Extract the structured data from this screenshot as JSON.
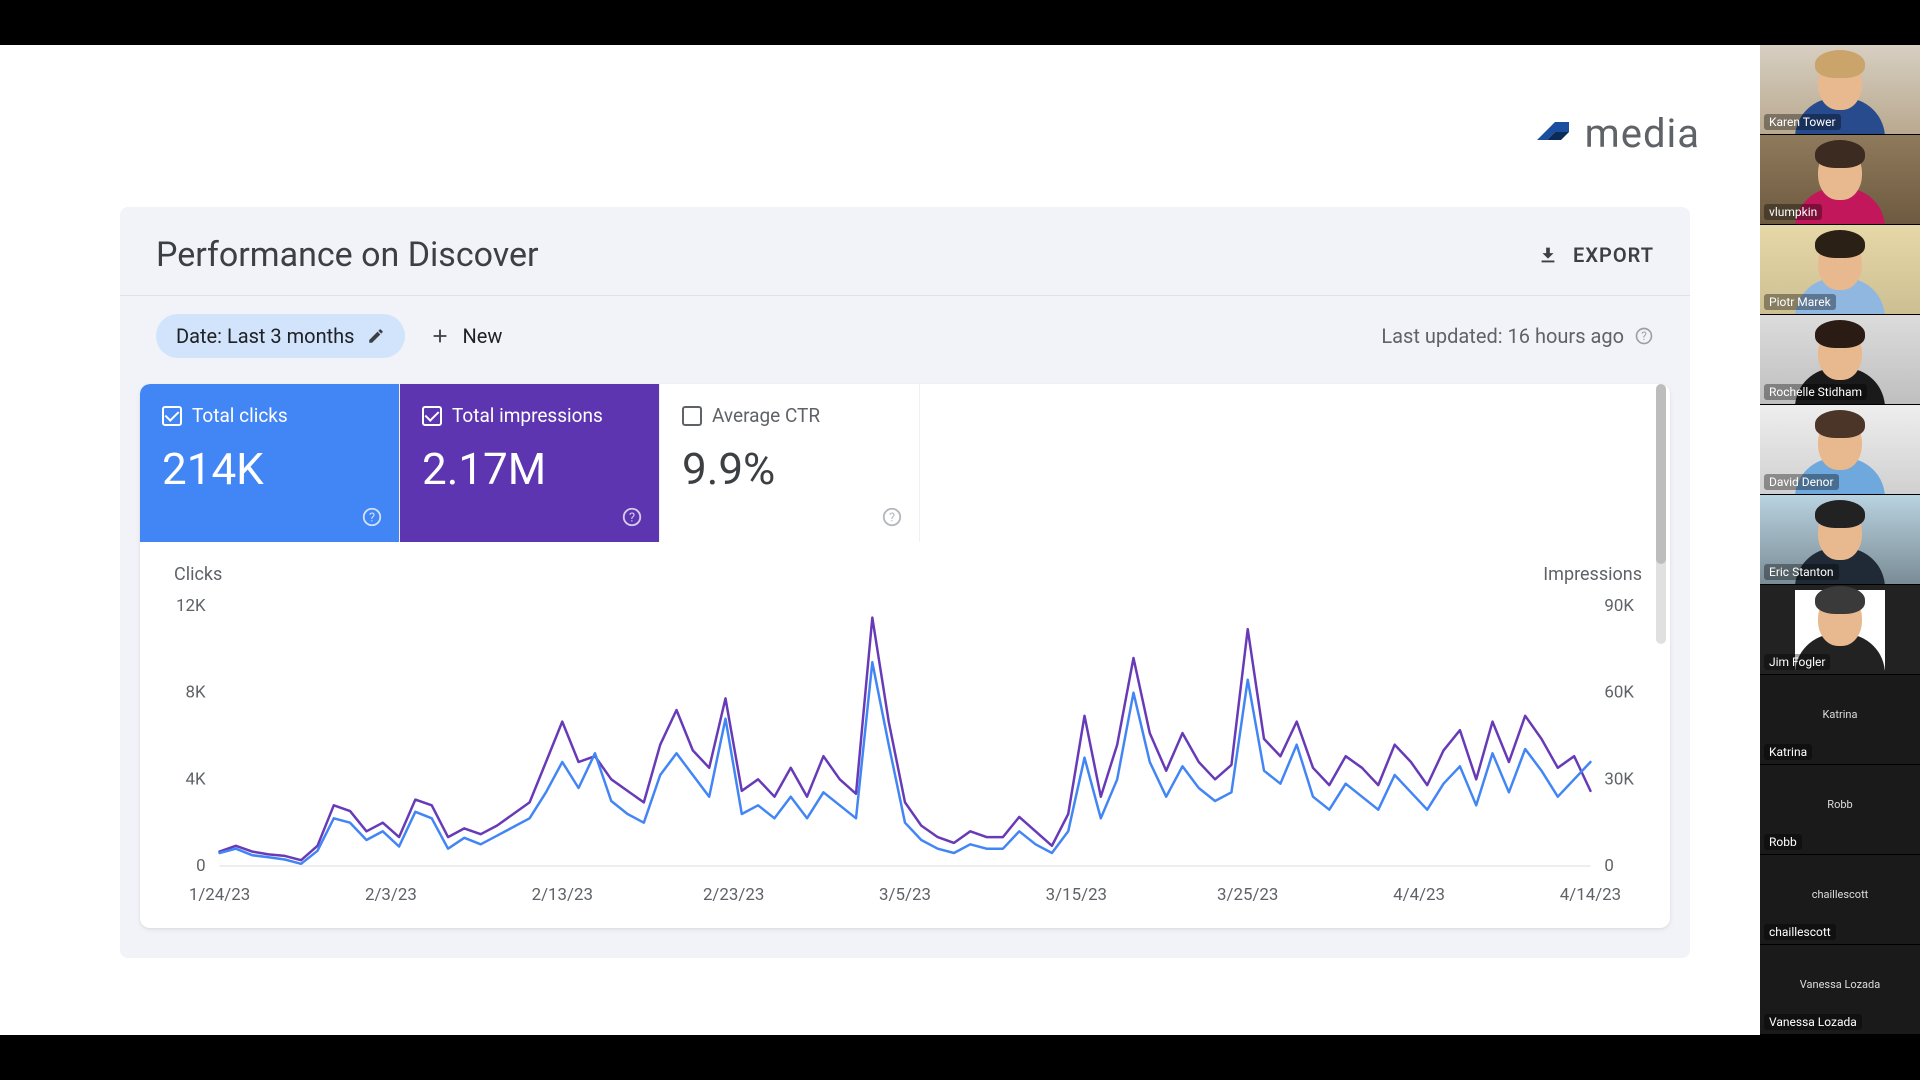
{
  "brand": {
    "name": "media"
  },
  "panel": {
    "title": "Performance on Discover",
    "export_label": "EXPORT",
    "date_chip": "Date: Last 3 months",
    "new_label": "New",
    "last_updated": "Last updated: 16 hours ago"
  },
  "metrics": {
    "clicks": {
      "label": "Total clicks",
      "value": "214K",
      "active": true
    },
    "impressions": {
      "label": "Total impressions",
      "value": "2.17M",
      "active": true
    },
    "ctr": {
      "label": "Average CTR",
      "value": "9.9%",
      "active": false
    }
  },
  "chart_data": {
    "type": "line",
    "title": "Performance on Discover",
    "left_axis_label": "Clicks",
    "right_axis_label": "Impressions",
    "y_left": {
      "min": 0,
      "max": 12000,
      "ticks": [
        0,
        4000,
        8000,
        12000
      ],
      "tick_labels": [
        "0",
        "4K",
        "8K",
        "12K"
      ]
    },
    "y_right": {
      "min": 0,
      "max": 90000,
      "ticks": [
        0,
        30000,
        60000,
        90000
      ],
      "tick_labels": [
        "0",
        "30K",
        "60K",
        "90K"
      ]
    },
    "x_labels": [
      "1/24/23",
      "2/3/23",
      "2/13/23",
      "2/23/23",
      "3/5/23",
      "3/15/23",
      "3/25/23",
      "4/4/23",
      "4/14/23"
    ],
    "days": 85,
    "series": [
      {
        "name": "Clicks",
        "axis": "left",
        "color": "#4285f4",
        "values": [
          600,
          800,
          500,
          400,
          300,
          100,
          700,
          2200,
          2000,
          1200,
          1600,
          900,
          2500,
          2200,
          800,
          1300,
          1000,
          1400,
          1800,
          2200,
          3400,
          4800,
          3600,
          5200,
          3000,
          2400,
          2000,
          4200,
          5200,
          4200,
          3200,
          6800,
          2400,
          2800,
          2200,
          3200,
          2200,
          3400,
          2800,
          2200,
          9400,
          5600,
          2000,
          1200,
          800,
          600,
          1000,
          800,
          800,
          1600,
          1000,
          600,
          1600,
          5000,
          2200,
          4000,
          8000,
          4800,
          3200,
          4600,
          3600,
          3000,
          3400,
          8600,
          4400,
          3800,
          5600,
          3200,
          2600,
          3800,
          3200,
          2600,
          4200,
          3400,
          2600,
          3800,
          4600,
          2800,
          5200,
          3400,
          5400,
          4400,
          3200,
          4000,
          4800
        ]
      },
      {
        "name": "Impressions",
        "axis": "right",
        "color": "#673ab7",
        "values": [
          5000,
          7000,
          5000,
          4000,
          3500,
          2000,
          7000,
          21000,
          19000,
          12000,
          15000,
          10000,
          23000,
          21000,
          10000,
          13000,
          11000,
          14000,
          18000,
          22000,
          36000,
          50000,
          36000,
          38000,
          30000,
          26000,
          22000,
          42000,
          54000,
          40000,
          34000,
          58000,
          26000,
          30000,
          24000,
          34000,
          24000,
          38000,
          30000,
          25000,
          86000,
          50000,
          22000,
          14000,
          10000,
          8000,
          12000,
          10000,
          10000,
          17000,
          12000,
          7000,
          18000,
          52000,
          24000,
          42000,
          72000,
          46000,
          33000,
          46000,
          36000,
          30000,
          35000,
          82000,
          44000,
          38000,
          50000,
          34000,
          28000,
          38000,
          34000,
          28000,
          42000,
          36000,
          28000,
          40000,
          47000,
          30000,
          50000,
          36000,
          52000,
          44000,
          34000,
          38000,
          26000
        ]
      }
    ]
  },
  "zoom": {
    "participants": [
      {
        "name": "Karen Tower",
        "avatar": true,
        "shirt": "#274b8c",
        "hair": "#caa46a",
        "bg_top": "#d7cfc2",
        "bg_bot": "#b9a98f"
      },
      {
        "name": "vlumpkin",
        "avatar": true,
        "shirt": "#c2185b",
        "hair": "#3b2b20",
        "bg_top": "#8f7a5c",
        "bg_bot": "#6e5a40"
      },
      {
        "name": "Piotr Marek",
        "avatar": true,
        "shirt": "#8fb7e0",
        "hair": "#2b2016",
        "bg_top": "#e7d8a8",
        "bg_bot": "#cdbf92"
      },
      {
        "name": "Rochelle Stidham",
        "avatar": true,
        "shirt": "#1a1a1a",
        "hair": "#2a1c14",
        "bg_top": "#dcdcdc",
        "bg_bot": "#bfbfbf"
      },
      {
        "name": "David Denor",
        "avatar": true,
        "shirt": "#6fa8dc",
        "hair": "#4a3528",
        "bg_top": "#eeeeee",
        "bg_bot": "#d0d0d0"
      },
      {
        "name": "Eric Stanton",
        "avatar": true,
        "shirt": "#1f2a36",
        "hair": "#222",
        "bg_top": "#b9d3e0",
        "bg_bot": "#7a8c96"
      },
      {
        "name": "Jim Fogler",
        "avatar": true,
        "shirt": "#222",
        "hair": "#3a3a3a",
        "bg_top": "#ffffff",
        "bg_bot": "#ffffff",
        "inset": true
      },
      {
        "name": "Katrina",
        "avatar": false
      },
      {
        "name": "Robb",
        "avatar": false
      },
      {
        "name": "chaillescott",
        "avatar": false
      },
      {
        "name": "Vanessa Lozada",
        "avatar": false
      }
    ]
  }
}
